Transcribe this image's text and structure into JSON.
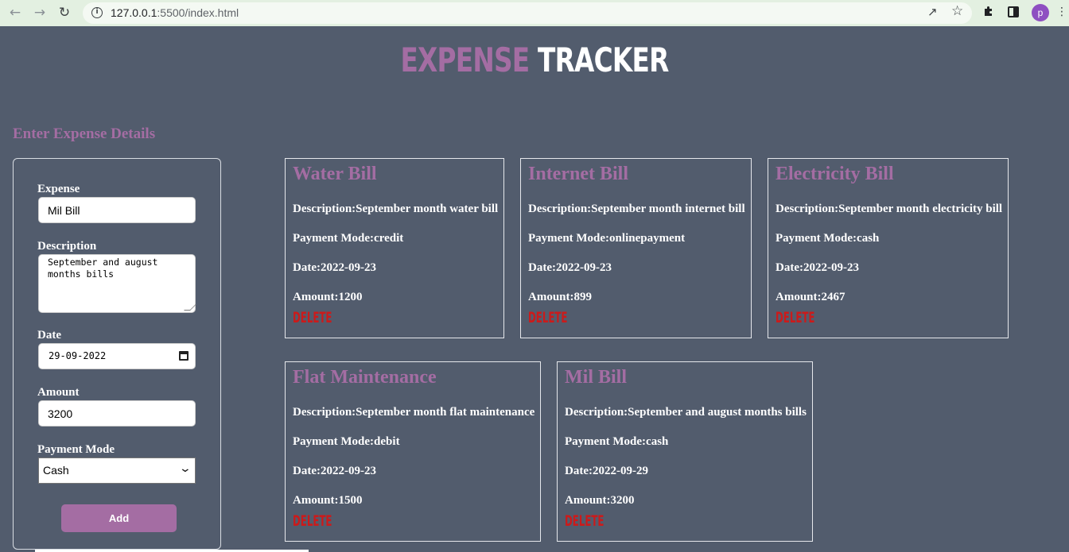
{
  "browser": {
    "url_host": "127.0.0.1",
    "url_rest": ":5500/index.html",
    "avatar_letter": "p",
    "icons": [
      "back-arrow-icon",
      "forward-arrow-icon",
      "reload-icon",
      "info-icon",
      "share-icon",
      "star-icon",
      "extensions-icon",
      "side-panel-icon",
      "avatar"
    ]
  },
  "app": {
    "title_part1": "EXPENSE",
    "title_part2": "TRACKER",
    "accent_color": "#a46da3",
    "background_color": "#525c6d",
    "delete_color": "#cc1a1a"
  },
  "form": {
    "section_title": "Enter Expense Details",
    "expense_label": "Expense",
    "expense_value": "Mil Bill",
    "description_label": "Description",
    "description_value": "September and august\nmonths bills",
    "date_label": "Date",
    "date_value": "29-09-2022",
    "amount_label": "Amount",
    "amount_value": "3200",
    "payment_label": "Payment Mode",
    "payment_value": "Cash",
    "add_label": "Add"
  },
  "expenses": [
    {
      "title": "Water Bill",
      "description": "Description:September month water bill",
      "payment": "Payment Mode:credit",
      "date": "Date:2022-09-23",
      "amount": "Amount:1200",
      "delete_label": "DELETE"
    },
    {
      "title": "Internet Bill",
      "description": "Description:September month internet bill",
      "payment": "Payment Mode:onlinepayment",
      "date": "Date:2022-09-23",
      "amount": "Amount:899",
      "delete_label": "DELETE"
    },
    {
      "title": "Electricity Bill",
      "description": "Description:September month electricity bill",
      "payment": "Payment Mode:cash",
      "date": "Date:2022-09-23",
      "amount": "Amount:2467",
      "delete_label": "DELETE"
    },
    {
      "title": "Flat Maintenance",
      "description": "Description:September month flat maintenance",
      "payment": "Payment Mode:debit",
      "date": "Date:2022-09-23",
      "amount": "Amount:1500",
      "delete_label": "DELETE"
    },
    {
      "title": "Mil Bill",
      "description": "Description:September and august months bills",
      "payment": "Payment Mode:cash",
      "date": "Date:2022-09-29",
      "amount": "Amount:3200",
      "delete_label": "DELETE"
    }
  ]
}
